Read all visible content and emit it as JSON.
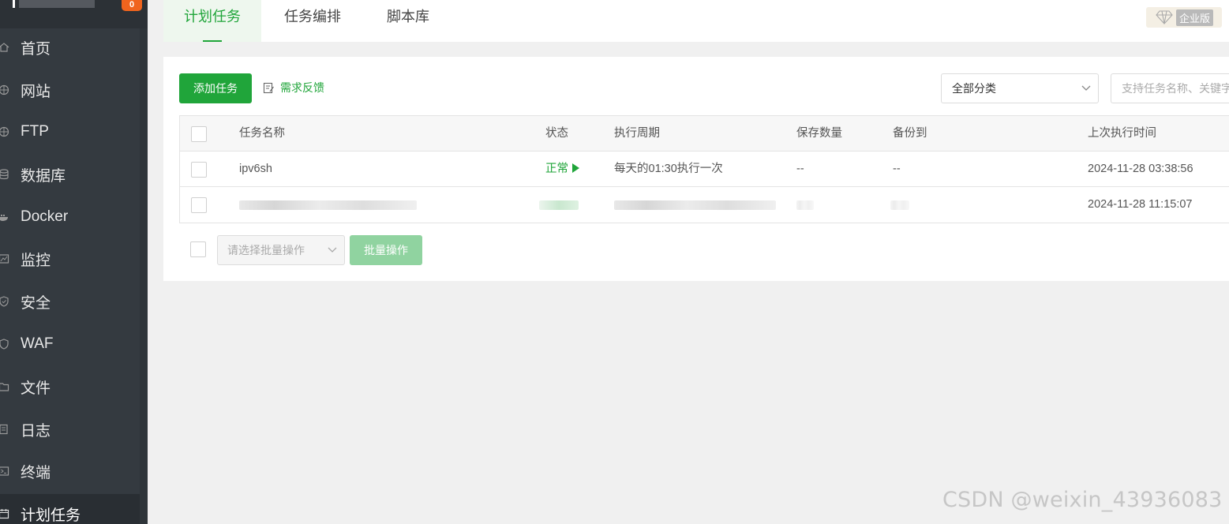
{
  "sidebar": {
    "badge": "0",
    "items": [
      {
        "label": "首页",
        "icon": "home-icon"
      },
      {
        "label": "网站",
        "icon": "globe-icon"
      },
      {
        "label": "FTP",
        "icon": "ftp-globe-icon"
      },
      {
        "label": "数据库",
        "icon": "database-icon"
      },
      {
        "label": "Docker",
        "icon": "docker-icon"
      },
      {
        "label": "监控",
        "icon": "monitor-chart-icon"
      },
      {
        "label": "安全",
        "icon": "shield-icon"
      },
      {
        "label": "WAF",
        "icon": "waf-shield-icon"
      },
      {
        "label": "文件",
        "icon": "folder-icon"
      },
      {
        "label": "日志",
        "icon": "log-icon"
      },
      {
        "label": "终端",
        "icon": "terminal-icon"
      },
      {
        "label": "计划任务",
        "icon": "calendar-icon",
        "active": true
      }
    ]
  },
  "tabs": [
    "计划任务",
    "任务编排",
    "脚本库"
  ],
  "enterprise_label": "企业版",
  "toolbar": {
    "add_task": "添加任务",
    "feedback": "需求反馈",
    "category_select": "全部分类",
    "search_placeholder": "支持任务名称、关键字"
  },
  "table": {
    "columns": [
      "任务名称",
      "状态",
      "执行周期",
      "保存数量",
      "备份到",
      "上次执行时间"
    ],
    "rows": [
      {
        "name": "ipv6sh",
        "status": "正常",
        "cycle": "每天的01:30执行一次",
        "save_count": "--",
        "backup_to": "--",
        "last_run": "2024-11-28 03:38:56"
      },
      {
        "name": "",
        "status": "",
        "cycle": "",
        "save_count": "",
        "backup_to": "",
        "last_run": "2024-11-28 11:15:07"
      }
    ]
  },
  "batch": {
    "select_placeholder": "请选择批量操作",
    "button": "批量操作"
  },
  "watermark": "CSDN @weixin_43936083",
  "colors": {
    "accent": "#20a53a",
    "sidebar_bg": "#343a40",
    "page_bg": "#f0f0f0"
  }
}
